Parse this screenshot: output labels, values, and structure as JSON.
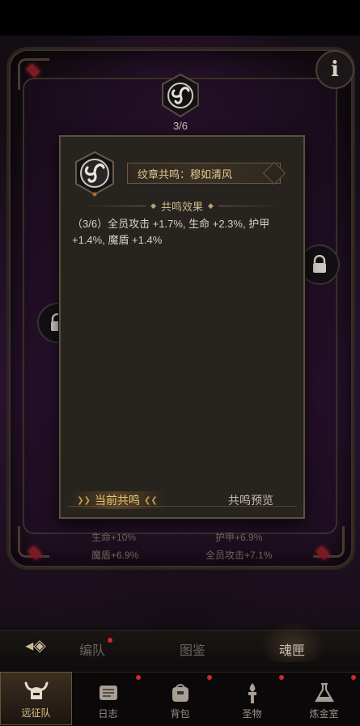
{
  "top_emblem": {
    "counter": "3/6",
    "icon": "triskele-icon"
  },
  "info_button": {
    "label": "i"
  },
  "popup": {
    "title": "纹章共鸣：穆如清风",
    "section_title": "共鸣效果",
    "effect_line1": "（3/6）全员攻击 +1.7%, 生命 +2.3%, 护甲",
    "effect_line2": "+1.4%, 魔盾 +1.4%",
    "tabs": {
      "current": "当前共鸣",
      "preview": "共鸣预览"
    }
  },
  "stats": {
    "left_top": "生命+10%",
    "left_bottom": "魔盾+6.9%",
    "right_top": "护甲+6.9%",
    "right_bottom": "全员攻击+7.1%"
  },
  "sub_tabs": [
    {
      "label": "编队",
      "badge": true
    },
    {
      "label": "图鉴",
      "badge": false
    },
    {
      "label": "魂匣",
      "badge": false,
      "active": true
    }
  ],
  "nav": [
    {
      "label": "远征队",
      "icon": "horned-helmet-icon",
      "active": true
    },
    {
      "label": "日志",
      "icon": "scroll-icon",
      "badge": true
    },
    {
      "label": "背包",
      "icon": "bag-icon",
      "badge": true
    },
    {
      "label": "圣物",
      "icon": "torch-icon",
      "badge": true
    },
    {
      "label": "炼金室",
      "icon": "alchemy-icon",
      "badge": true
    }
  ],
  "colors": {
    "accent_gold": "#e3c78d",
    "badge_red": "#d02626",
    "panel": "#27231f"
  }
}
